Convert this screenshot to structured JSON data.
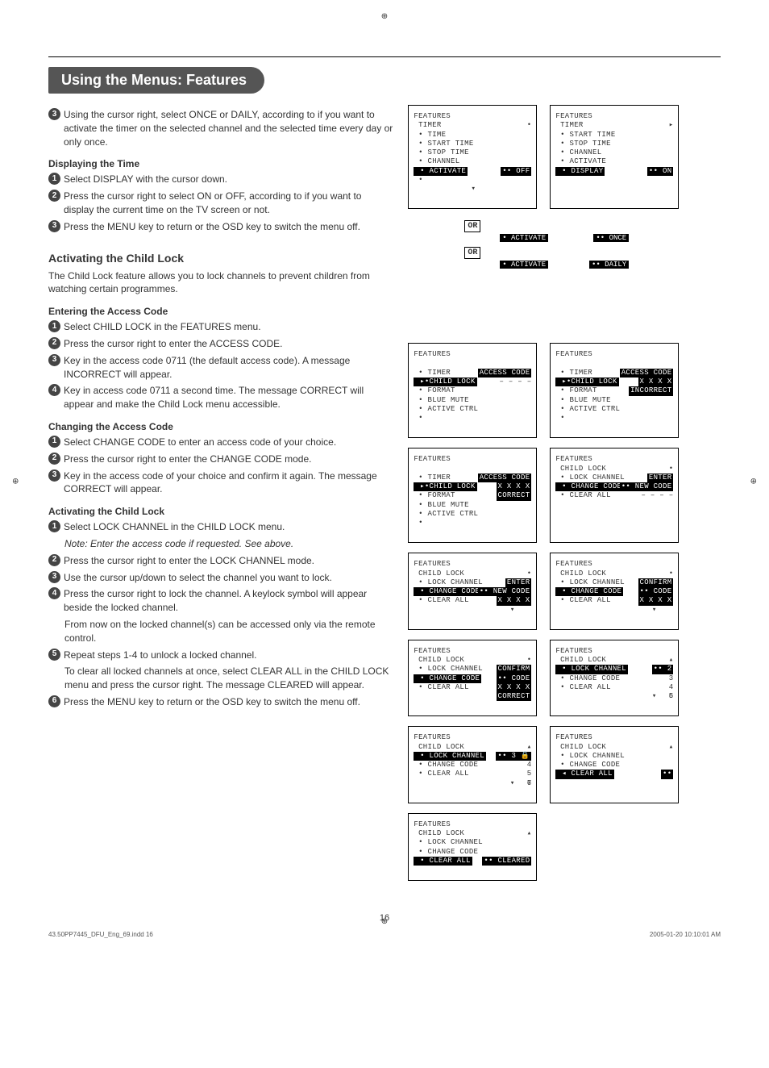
{
  "title": "Using the Menus: Features",
  "intro_step": "Using the cursor right, select ONCE or DAILY, according to if you want to activate the timer on the selected channel and the selected time every day or only once.",
  "display_time": {
    "heading": "Displaying the Time",
    "s1": "Select DISPLAY with the cursor down.",
    "s2": "Press the cursor right to select ON or OFF, according to if you want to display the current time on the TV screen or not.",
    "s3": "Press the MENU key to return or the OSD key to switch the menu off."
  },
  "child_lock_intro": {
    "heading": "Activating the Child Lock",
    "body": "The Child Lock feature allows you to lock channels to prevent children from watching certain programmes."
  },
  "entering_code": {
    "heading": "Entering the Access Code",
    "s1": "Select CHILD LOCK in the FEATURES menu.",
    "s2": "Press the cursor right to enter the ACCESS CODE.",
    "s3": "Key in the access code 0711 (the default access code). A message INCORRECT will appear.",
    "s4": "Key in access code 0711 a second time. The message CORRECT will appear and make the Child Lock menu accessible."
  },
  "changing_code": {
    "heading": "Changing the Access Code",
    "s1": "Select CHANGE CODE to enter an access code of your choice.",
    "s2": "Press the cursor right to enter the CHANGE CODE mode.",
    "s3": "Key in the access code of your choice and confirm it again. The message CORRECT will appear."
  },
  "activating": {
    "heading": "Activating the Child Lock",
    "s1": "Select LOCK CHANNEL in the CHILD LOCK menu.",
    "note": "Note: Enter the access code if requested. See above.",
    "s2": "Press the cursor right to enter the LOCK CHANNEL mode.",
    "s3": "Use the cursor up/down to select the channel you want to lock.",
    "s4": "Press the cursor right to lock the channel. A keylock symbol will appear beside the locked channel.",
    "s4b": "From now on the locked channel(s) can be accessed only via the remote control.",
    "s5": "Repeat steps 1-4 to unlock a locked channel.",
    "s5b": "To clear all locked channels at once, select CLEAR ALL in the CHILD LOCK menu and press the cursor right. The message CLEARED will appear.",
    "s6": "Press the MENU key to return or the OSD key to switch the menu off."
  },
  "osd": {
    "feat": "FEATURES",
    "timer": " TIMER",
    "time": " • TIME",
    "start": " • START TIME",
    "stop": " • STOP TIME",
    "channel": " • CHANNEL",
    "activate": " • ACTIVATE",
    "display": " • DISPLAY",
    "off": "•• OFF",
    "on": "•• ON",
    "once": "•• ONCE",
    "daily": "•• DAILY",
    "or": "OR",
    "timer_i": " • TIMER",
    "childlock_sel": " ▸•CHILD LOCK",
    "format": " • FORMAT",
    "bluemute": " • BLUE MUTE",
    "activectrl": " • ACTIVE CTRL",
    "access": "ACCESS CODE",
    "dashes": "– – – –",
    "xxxx": "X X X X",
    "incorrect": "INCORRECT",
    "correct": "CORRECT",
    "childlock_h": " CHILD LOCK",
    "lockch": " • LOCK CHANNEL",
    "changecode": " • CHANGE CODE",
    "clearall": " • CLEAR ALL",
    "enter": "ENTER",
    "newcode": "•• NEW CODE",
    "confirm": "CONFIRM",
    "code": "•• CODE",
    "n2": "•• 2",
    "n3": "   3",
    "n4": "   4",
    "n5": "   5",
    "n6": "   6",
    "n7": "   7",
    "n3l": "•• 3 🔒",
    "cleared": "•• CLEARED",
    "clearall_sel": " ◂ CLEAR ALL"
  },
  "page_number": "16",
  "footer_left": "43.50PP7445_DFU_Eng_69.indd   16",
  "footer_right": "2005-01-20   10:10:01 AM"
}
